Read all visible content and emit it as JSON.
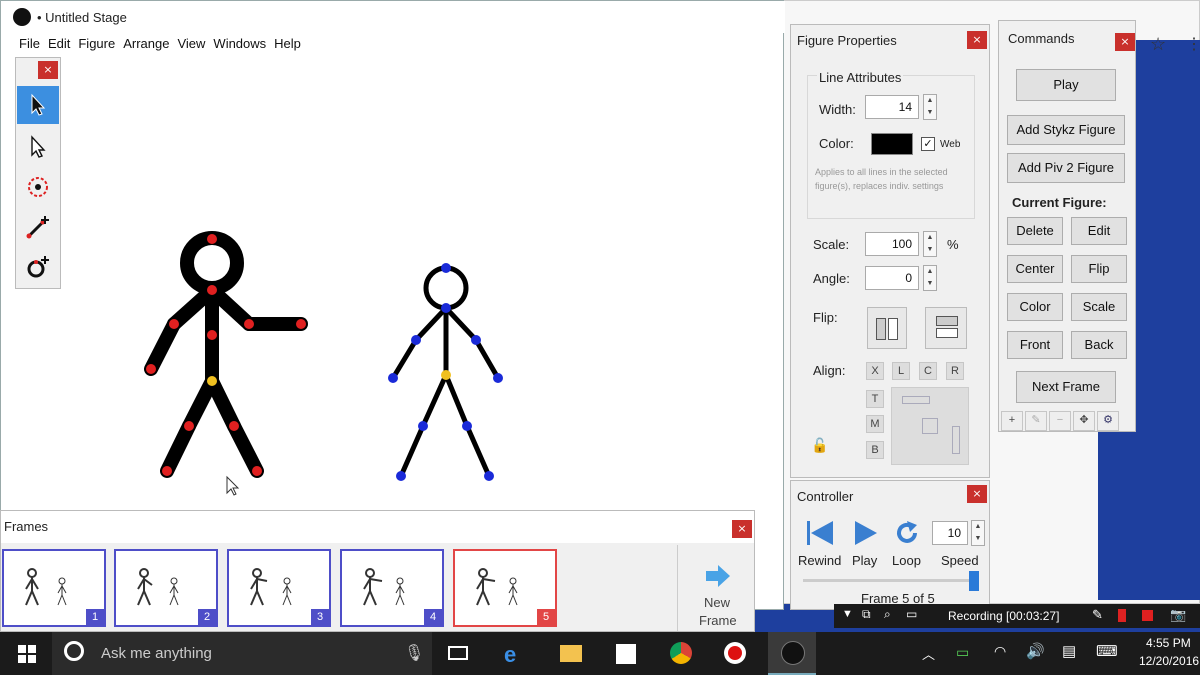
{
  "stage": {
    "title": "• Untitled Stage",
    "menu": [
      "File",
      "Edit",
      "Figure",
      "Arrange",
      "View",
      "Windows",
      "Help"
    ]
  },
  "tools": [
    "select-arrow",
    "select-arrow-outline",
    "pivot-tool",
    "add-line",
    "add-circle"
  ],
  "figure_properties": {
    "title": "Figure Properties",
    "line_attributes": "Line Attributes",
    "width_label": "Width:",
    "width_value": "14",
    "color_label": "Color:",
    "color_value": "#000000",
    "web_label": "Web",
    "web_checked": true,
    "note": "Applies to all lines in the selected figure(s), replaces indiv. settings",
    "scale_label": "Scale:",
    "scale_value": "100",
    "scale_unit": "%",
    "angle_label": "Angle:",
    "angle_value": "0",
    "flip_label": "Flip:",
    "align_label": "Align:",
    "align_h": [
      "X",
      "L",
      "C",
      "R"
    ],
    "align_v": [
      "T",
      "M",
      "B"
    ]
  },
  "commands": {
    "title": "Commands",
    "play": "Play",
    "add_stykz": "Add Stykz Figure",
    "add_piv2": "Add Piv 2 Figure",
    "current_figure": "Current Figure:",
    "buttons": [
      "Delete",
      "Edit",
      "Center",
      "Flip",
      "Color",
      "Scale",
      "Front",
      "Back"
    ],
    "next_frame": "Next Frame",
    "toolbar": [
      "+",
      "✎",
      "−",
      "✥",
      "⚙"
    ]
  },
  "controller": {
    "title": "Controller",
    "rewind": "Rewind",
    "play": "Play",
    "loop": "Loop",
    "speed": "Speed",
    "speed_value": "10",
    "frame_status": "Frame 5 of 5"
  },
  "frames": {
    "title": "Frames",
    "items": [
      "1",
      "2",
      "3",
      "4",
      "5"
    ],
    "selected": "5",
    "new_frame_line1": "New",
    "new_frame_line2": "Frame"
  },
  "recording": {
    "text": "Recording [00:03:27]"
  },
  "taskbar": {
    "search_placeholder": "Ask me anything",
    "time": "4:55 PM",
    "date": "12/20/2016"
  },
  "colors": {
    "joint_red": "#e02020",
    "joint_blue": "#1a2ad8",
    "joint_yellow": "#f0c020",
    "frame_border": "#4e4ec8",
    "frame_selected": "#e24646",
    "desktop": "#1e3f9e"
  }
}
